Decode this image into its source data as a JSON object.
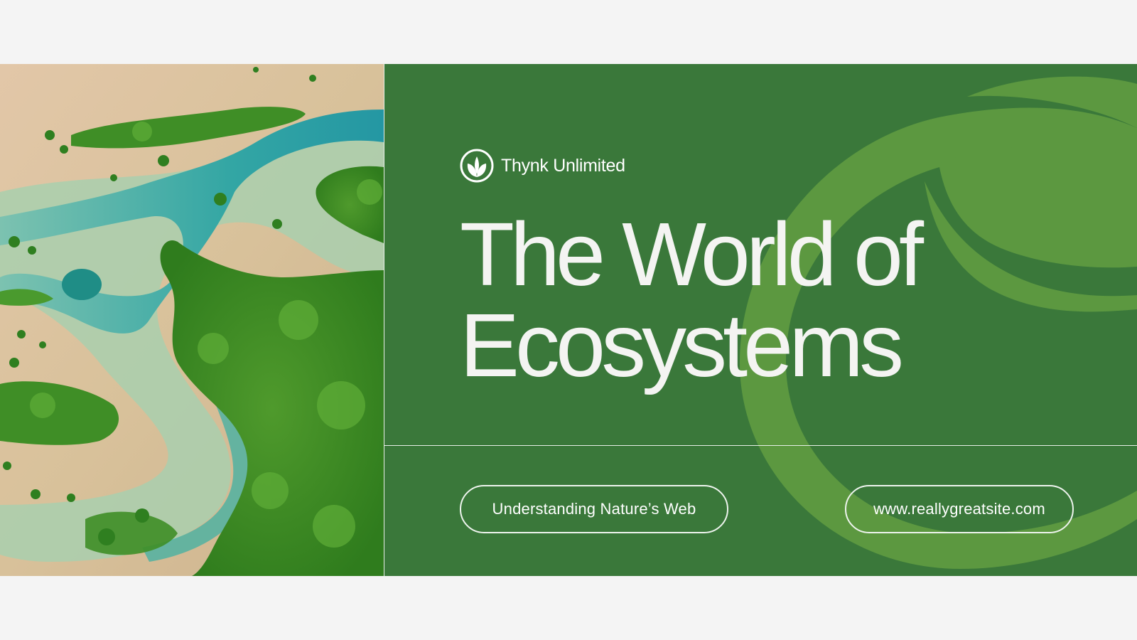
{
  "brand": {
    "name": "Thynk Unlimited",
    "icon": "leaf-sprout-icon"
  },
  "title": {
    "line1": "The World of",
    "line2": "Ecosystems"
  },
  "tagline": "Understanding Nature’s Web",
  "website": "www.reallygreatsite.com",
  "photo": {
    "subject": "aerial-mangrove-river-image"
  },
  "colors": {
    "page_background": "#f4f4f4",
    "panel_green": "#3a783a",
    "leaf_green": "#5c9840",
    "text": "#ffffff"
  }
}
